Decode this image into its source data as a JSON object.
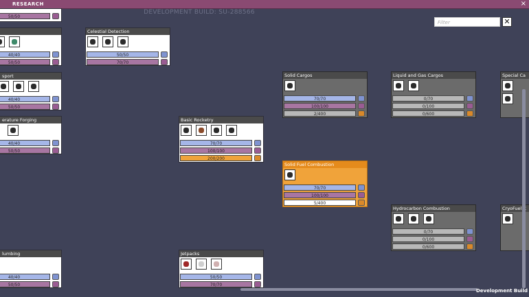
{
  "window": {
    "title": "RESEARCH",
    "close": "×"
  },
  "build_label": "DEVELOPMENT BUILD: SU-288566",
  "filter": {
    "placeholder": "Filter",
    "clear": "✕"
  },
  "footer": "Development Build",
  "cards": [
    {
      "title": "",
      "bars": [
        "",
        "50/50"
      ]
    },
    {
      "title": "",
      "bars": [
        "40/40",
        "50/50"
      ]
    },
    {
      "title": "Celestial Detection",
      "bars": [
        "50/50",
        "70/70"
      ]
    },
    {
      "title": "sport",
      "bars": [
        "40/40",
        "50/50"
      ]
    },
    {
      "title": "erature Forging",
      "bars": [
        "40/40",
        "50/50"
      ]
    },
    {
      "title": "Basic Rocketry",
      "bars": [
        "70/70",
        "100/100",
        "200/200"
      ]
    },
    {
      "title": "Solid Cargos",
      "bars": [
        "70/70",
        "100/100",
        "2/400"
      ]
    },
    {
      "title": "Liquid and Gas Cargos",
      "bars": [
        "0/70",
        "0/100",
        "0/600"
      ]
    },
    {
      "title": "Special Ca",
      "bars": []
    },
    {
      "title": "Solid Fuel Combustion",
      "bars": [
        "70/70",
        "100/100",
        "5/400"
      ]
    },
    {
      "title": "Hydrocarbon Combustion",
      "bars": [
        "0/70",
        "0/100",
        "0/600"
      ]
    },
    {
      "title": "CryoFuel C",
      "bars": []
    },
    {
      "title": "lumbing",
      "bars": [
        "40/40",
        "50/50"
      ]
    },
    {
      "title": "Jetpacks",
      "bars": [
        "50/50",
        "70/70"
      ]
    }
  ]
}
